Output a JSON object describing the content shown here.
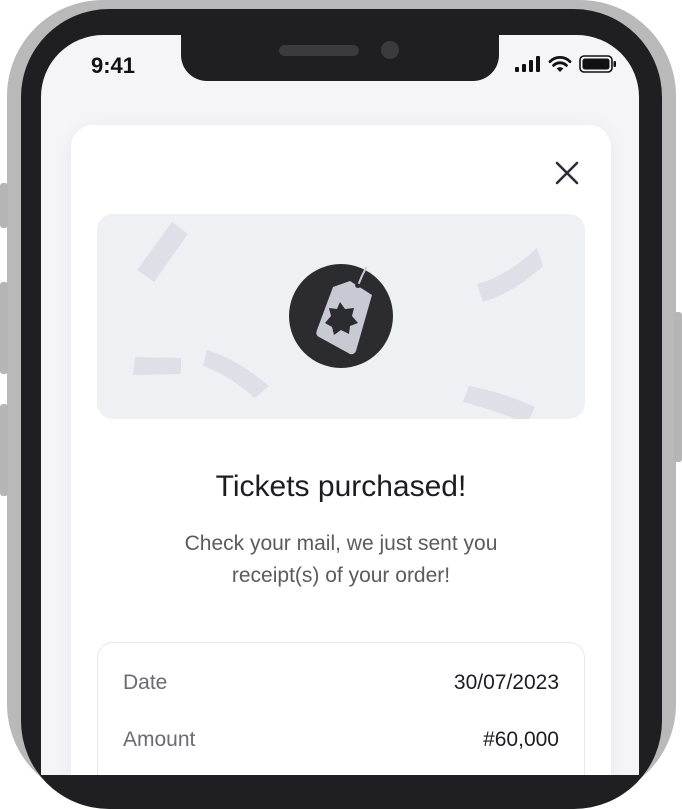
{
  "status_bar": {
    "time": "9:41",
    "icons": [
      "signal-icon",
      "wifi-icon",
      "battery-icon"
    ]
  },
  "modal": {
    "close_icon": "close-icon",
    "banner_icon": "price-tag-icon",
    "title": "Tickets purchased!",
    "message": "Check your mail, we just sent you receipt(s) of your order!",
    "details": [
      {
        "label": "Date",
        "value": "30/07/2023"
      },
      {
        "label": "Amount",
        "value": "#60,000"
      }
    ]
  },
  "colors": {
    "screen_background": "#f5f5f8",
    "card_background": "#ffffff",
    "banner_background": "#eff0f4",
    "icon_circle": "#2b2b30",
    "tag_fill": "#c8cad3",
    "title_text": "#1c1c22",
    "muted_text": "#5a5a66"
  }
}
